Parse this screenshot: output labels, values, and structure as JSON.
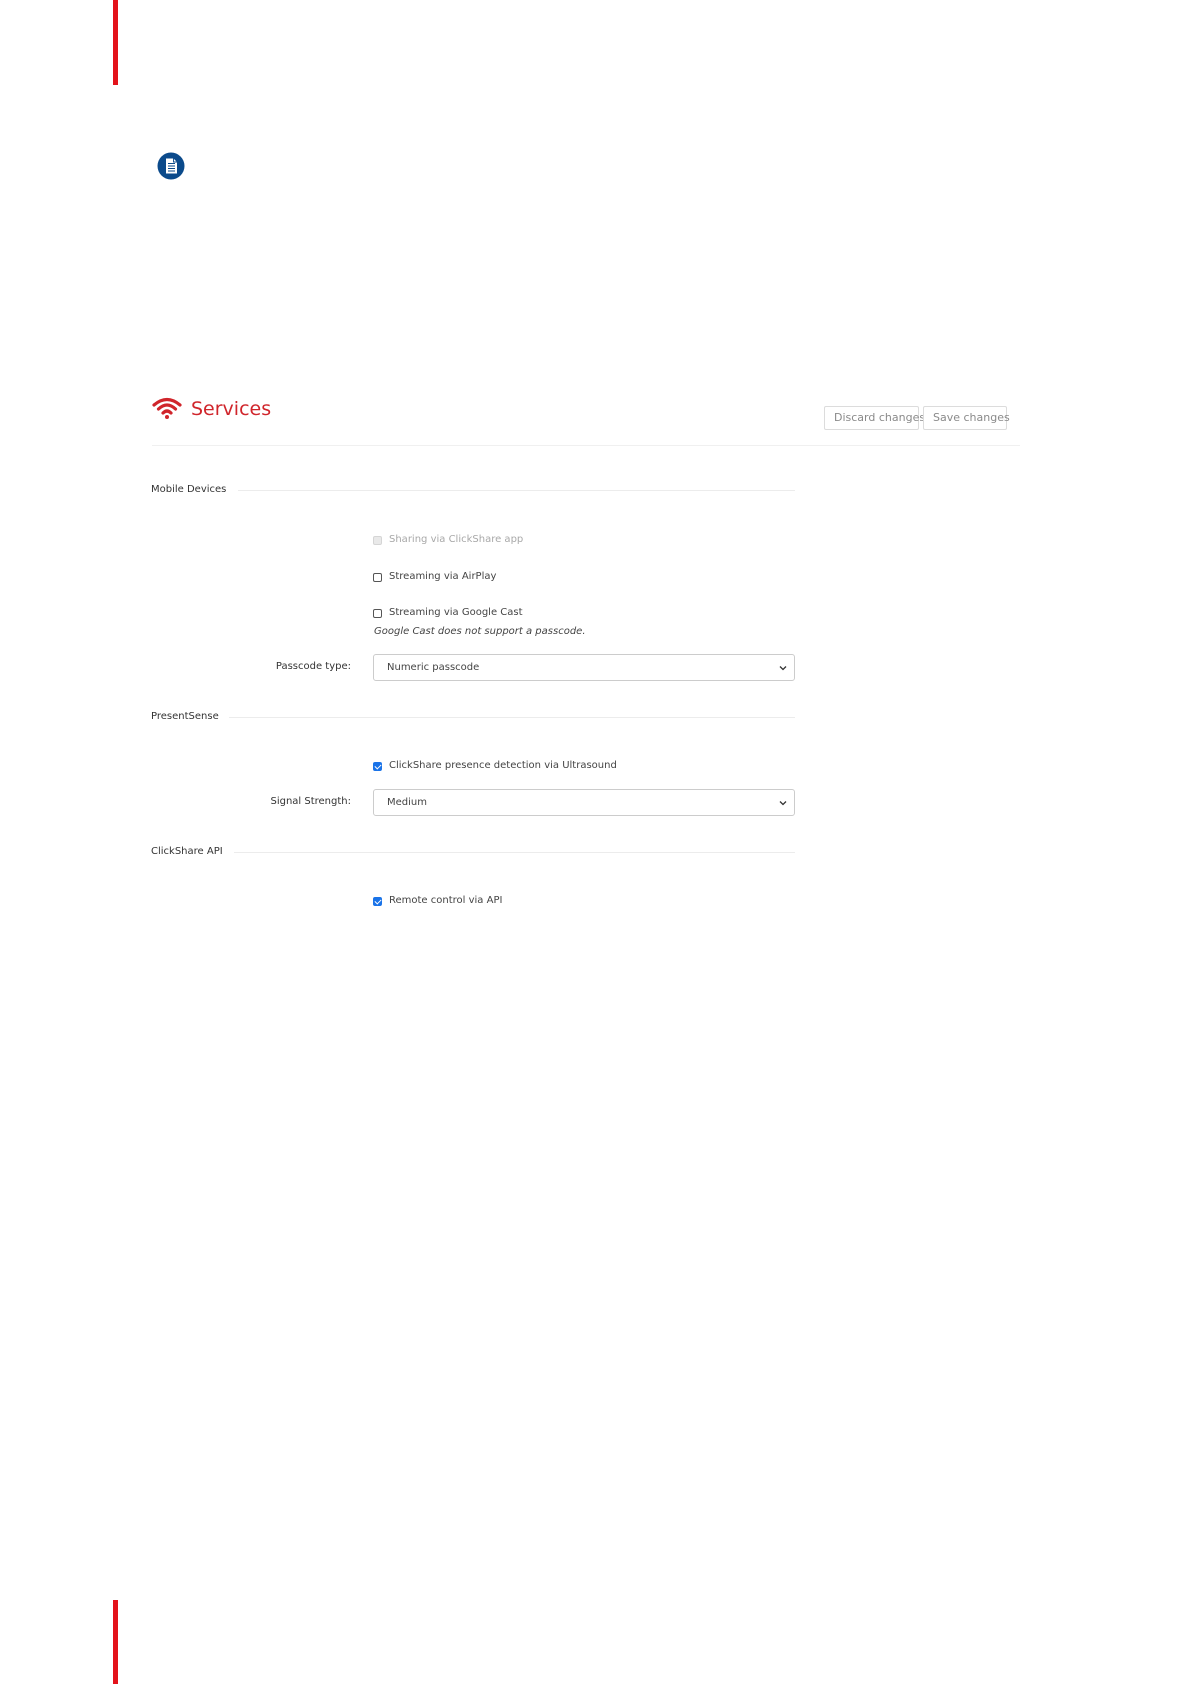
{
  "header": {
    "title": "Services",
    "discard_label": "Discard changes",
    "save_label": "Save changes",
    "accent_color": "#d0252b"
  },
  "mobile_devices": {
    "title": "Mobile Devices",
    "options": [
      {
        "label": "Sharing via ClickShare app",
        "checked": false,
        "disabled": true
      },
      {
        "label": "Streaming via AirPlay",
        "checked": false,
        "disabled": false
      },
      {
        "label": "Streaming via Google Cast",
        "checked": false,
        "disabled": false
      }
    ],
    "google_cast_note": "Google Cast does not support a passcode.",
    "passcode_label": "Passcode type:",
    "passcode_value": "Numeric passcode"
  },
  "presentsense": {
    "title": "PresentSense",
    "option": {
      "label": "ClickShare presence detection via Ultrasound",
      "checked": true
    },
    "signal_label": "Signal Strength:",
    "signal_value": "Medium"
  },
  "api": {
    "title": "ClickShare API",
    "option": {
      "label": "Remote control via API",
      "checked": true
    }
  },
  "icons": {
    "note": "note-icon",
    "wifi": "wifi-icon",
    "chevron": "chevron-down-icon"
  }
}
